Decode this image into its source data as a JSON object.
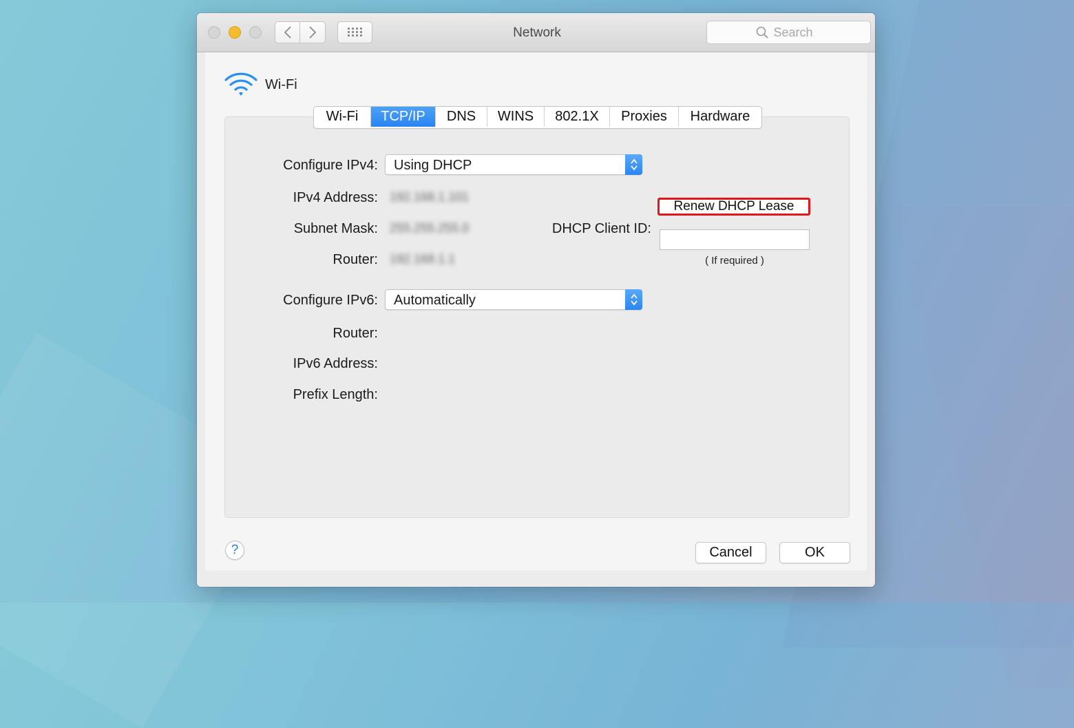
{
  "window": {
    "title": "Network",
    "search_placeholder": "Search"
  },
  "network": {
    "name": "Wi-Fi",
    "icon": "wifi-icon"
  },
  "tabs": [
    {
      "label": "Wi-Fi",
      "active": false
    },
    {
      "label": "TCP/IP",
      "active": true
    },
    {
      "label": "DNS",
      "active": false
    },
    {
      "label": "WINS",
      "active": false
    },
    {
      "label": "802.1X",
      "active": false
    },
    {
      "label": "Proxies",
      "active": false
    },
    {
      "label": "Hardware",
      "active": false
    }
  ],
  "ipv4": {
    "configure_label": "Configure IPv4:",
    "configure_value": "Using DHCP",
    "address_label": "IPv4 Address:",
    "address_value": "192.168.1.101",
    "subnet_label": "Subnet Mask:",
    "subnet_value": "255.255.255.0",
    "router_label": "Router:",
    "router_value": "192.168.1.1"
  },
  "dhcp": {
    "renew_label": "Renew DHCP Lease",
    "client_id_label": "DHCP Client ID:",
    "client_id_value": "",
    "client_id_hint": "( If required )"
  },
  "ipv6": {
    "configure_label": "Configure IPv6:",
    "configure_value": "Automatically",
    "router_label": "Router:",
    "address_label": "IPv6 Address:",
    "prefix_label": "Prefix Length:"
  },
  "footer": {
    "help_label": "?",
    "cancel_label": "Cancel",
    "ok_label": "OK"
  },
  "colors": {
    "accent": "#2a84f2",
    "highlight_border": "#e3161b",
    "minimize_light": "#f5bd2e"
  }
}
